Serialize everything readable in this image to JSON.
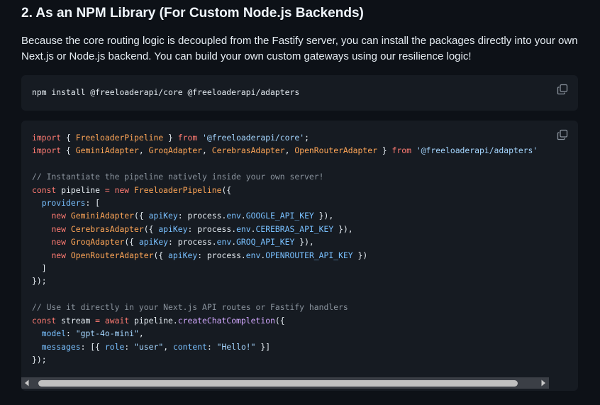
{
  "section": {
    "heading": "2. As an NPM Library (For Custom Node.js Backends)",
    "description": "Because the core routing logic is decoupled from the Fastify server, you can install the packages directly into your own Next.js or Node.js backend. You can build your own custom gateways using our resilience logic!"
  },
  "install_block": {
    "command": "npm install @freeloaderapi/core @freeloaderapi/adapters",
    "copy_icon": "copy-icon"
  },
  "code_block": {
    "copy_icon": "copy-icon",
    "line1": {
      "k1": "import",
      "p1": " { ",
      "c1": "FreeloaderPipeline",
      "p2": " } ",
      "k2": "from",
      "p3": " ",
      "s1": "'@freeloaderapi/core'",
      "p4": ";"
    },
    "line2": {
      "k1": "import",
      "p1": " { ",
      "c1": "GeminiAdapter",
      "p2": ", ",
      "c2": "GroqAdapter",
      "p3": ", ",
      "c3": "CerebrasAdapter",
      "p4": ", ",
      "c4": "OpenRouterAdapter",
      "p5": " } ",
      "k2": "from",
      "p6": " ",
      "s1": "'@freeloaderapi/adapters'"
    },
    "line4": "// Instantiate the pipeline natively inside your own server!",
    "line5": {
      "k1": "const",
      "p1": " pipeline ",
      "k2": "=",
      "p2": " ",
      "k3": "new",
      "p3": " ",
      "c1": "FreeloaderPipeline",
      "p4": "({"
    },
    "line6": {
      "indent": "  ",
      "prop": "providers",
      "p1": ": ["
    },
    "adapters": [
      {
        "indent": "    ",
        "k": "new",
        "cls": "GeminiAdapter",
        "open": "({ ",
        "prop": "apiKey",
        "mid": ": process.",
        "env": "env",
        "dot": ".",
        "key": "GOOGLE_API_KEY",
        "close": " }),"
      },
      {
        "indent": "    ",
        "k": "new",
        "cls": "CerebrasAdapter",
        "open": "({ ",
        "prop": "apiKey",
        "mid": ": process.",
        "env": "env",
        "dot": ".",
        "key": "CEREBRAS_API_KEY",
        "close": " }),"
      },
      {
        "indent": "    ",
        "k": "new",
        "cls": "GroqAdapter",
        "open": "({ ",
        "prop": "apiKey",
        "mid": ": process.",
        "env": "env",
        "dot": ".",
        "key": "GROQ_API_KEY",
        "close": " }),"
      },
      {
        "indent": "    ",
        "k": "new",
        "cls": "OpenRouterAdapter",
        "open": "({ ",
        "prop": "apiKey",
        "mid": ": process.",
        "env": "env",
        "dot": ".",
        "key": "OPENROUTER_API_KEY",
        "close": " })"
      }
    ],
    "line11": "  ]",
    "line12": "});",
    "line14": "// Use it directly in your Next.js API routes or Fastify handlers",
    "line15": {
      "k1": "const",
      "p1": " stream ",
      "k2": "=",
      "p2": " ",
      "k3": "await",
      "p3": " pipeline.",
      "f1": "createChatCompletion",
      "p4": "({"
    },
    "line16": {
      "indent": "  ",
      "prop": "model",
      "p1": ": ",
      "s1": "\"gpt-4o-mini\"",
      "p2": ","
    },
    "line17": {
      "indent": "  ",
      "prop": "messages",
      "p1": ": [{ ",
      "prop2": "role",
      "p2": ": ",
      "s1": "\"user\"",
      "p3": ", ",
      "prop3": "content",
      "p4": ": ",
      "s2": "\"Hello!\"",
      "p5": " }]"
    },
    "line18": "});"
  },
  "scrollbar": {
    "left_arrow": "chevron-left-icon",
    "right_arrow": "chevron-right-icon",
    "position": 0.0
  }
}
